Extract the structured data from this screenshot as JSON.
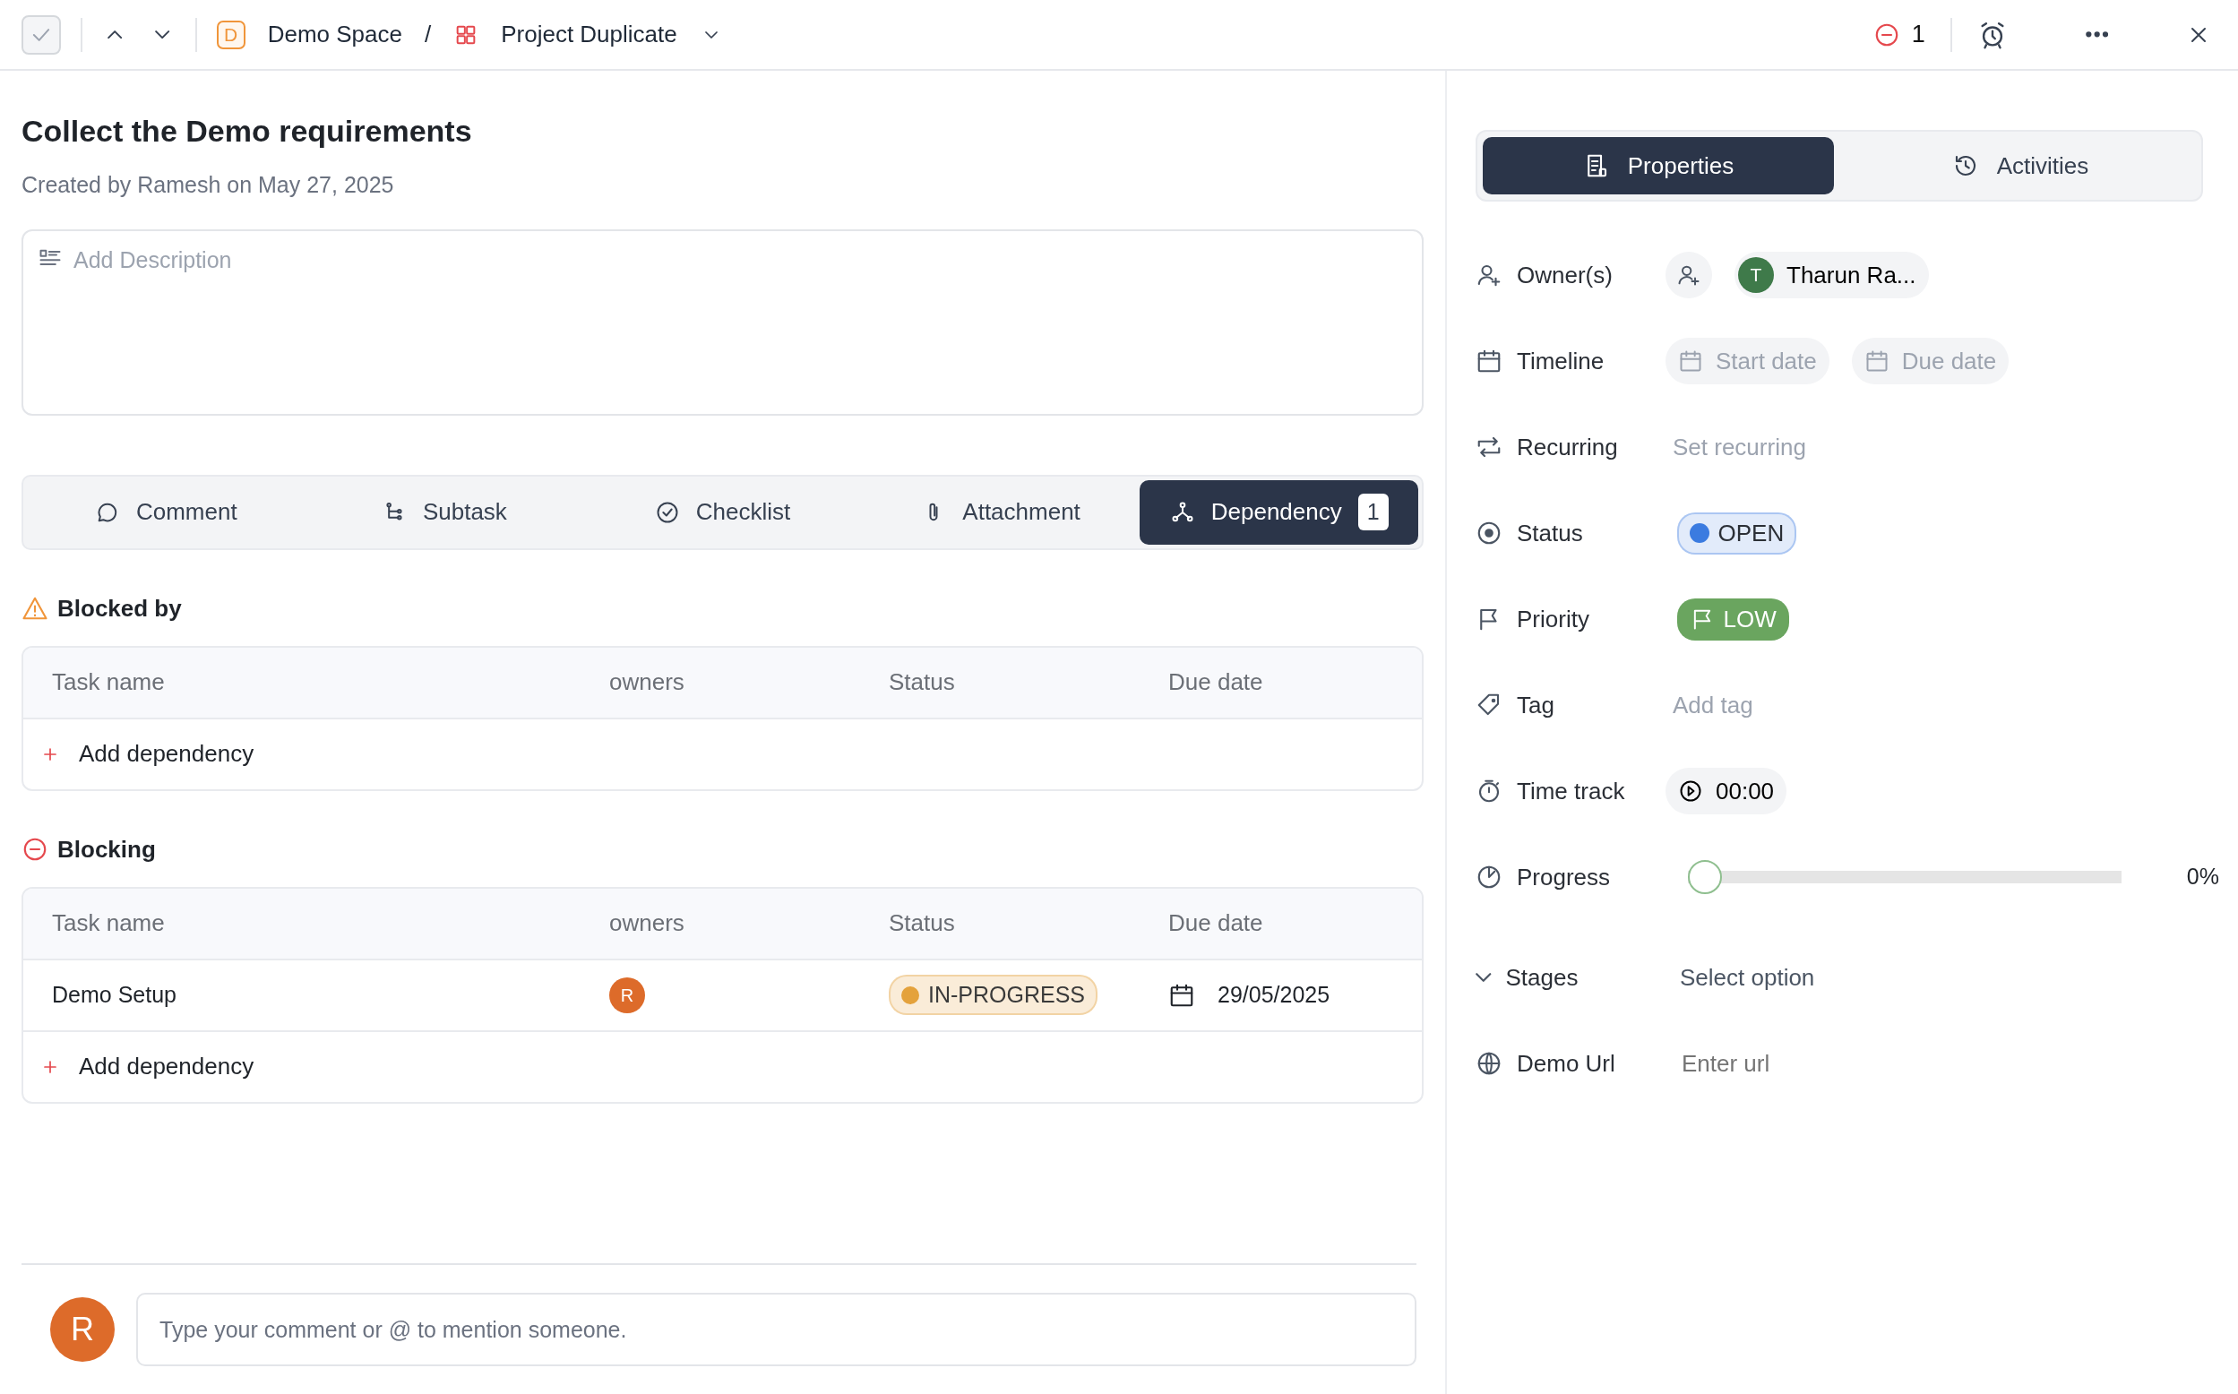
{
  "topbar": {
    "complete_checked": false,
    "breadcrumb": [
      {
        "badge": "D",
        "label": "Demo Space"
      },
      {
        "label": "Project Duplicate"
      }
    ],
    "separator": "/",
    "blocking_count": "1"
  },
  "task": {
    "title": "Collect the Demo requirements",
    "created": "Created by Ramesh on May 27, 2025"
  },
  "description": {
    "placeholder": "Add Description"
  },
  "tabs": [
    {
      "kind": "comment",
      "label": "Comment",
      "selected": false
    },
    {
      "kind": "subtask",
      "label": "Subtask",
      "selected": false
    },
    {
      "kind": "checklist",
      "label": "Checklist",
      "selected": false
    },
    {
      "kind": "attachment",
      "label": "Attachment",
      "selected": false
    },
    {
      "kind": "dependency",
      "label": "Dependency",
      "count": "1",
      "selected": true
    }
  ],
  "sections": [
    {
      "kind": "blocked_by",
      "title": "Blocked by",
      "columns": [
        "Task name",
        "owners",
        "Status",
        "Due date"
      ],
      "add_label": "Add dependency"
    },
    {
      "kind": "blocking",
      "title": "Blocking",
      "columns": [
        "Task name",
        "owners",
        "Status",
        "Due date"
      ],
      "rows": [
        {
          "name": "Demo Setup",
          "owner": {
            "initial": "R",
            "color": "#dd6b2a"
          },
          "status": {
            "label": "IN-PROGRESS",
            "color": "#e4a23c"
          },
          "due": "29/05/2025"
        }
      ],
      "add_label": "Add dependency"
    }
  ],
  "comment": {
    "avatar": {
      "initial": "R",
      "color": "#dd6b2a"
    },
    "placeholder": "Type your comment or @ to mention someone."
  },
  "panel_tabs": [
    {
      "kind": "properties",
      "label": "Properties",
      "selected": true
    },
    {
      "kind": "activities",
      "label": "Activities",
      "selected": false
    }
  ],
  "properties": [
    {
      "kind": "owners",
      "label": "Owner(s)",
      "owners": [
        {
          "initial": "T",
          "name": "Tharun Ra...",
          "color": "#3f7a4a"
        }
      ]
    },
    {
      "kind": "timeline",
      "label": "Timeline",
      "start": "Start date",
      "due": "Due date"
    },
    {
      "kind": "recurring",
      "label": "Recurring",
      "placeholder": "Set recurring"
    },
    {
      "kind": "status",
      "label": "Status",
      "value": "OPEN",
      "color": "#3b7be0"
    },
    {
      "kind": "priority",
      "label": "Priority",
      "value": "LOW",
      "color": "#6aa55f"
    },
    {
      "kind": "tag",
      "label": "Tag",
      "placeholder": "Add tag"
    },
    {
      "kind": "timetrack",
      "label": "Time track",
      "value": "00:00"
    },
    {
      "kind": "progress",
      "label": "Progress",
      "level": 0,
      "reading": "0%"
    },
    {
      "kind": "stages",
      "label": "Stages",
      "value": "Select option"
    },
    {
      "kind": "url",
      "label": "Demo Url",
      "placeholder": "Enter url"
    }
  ]
}
